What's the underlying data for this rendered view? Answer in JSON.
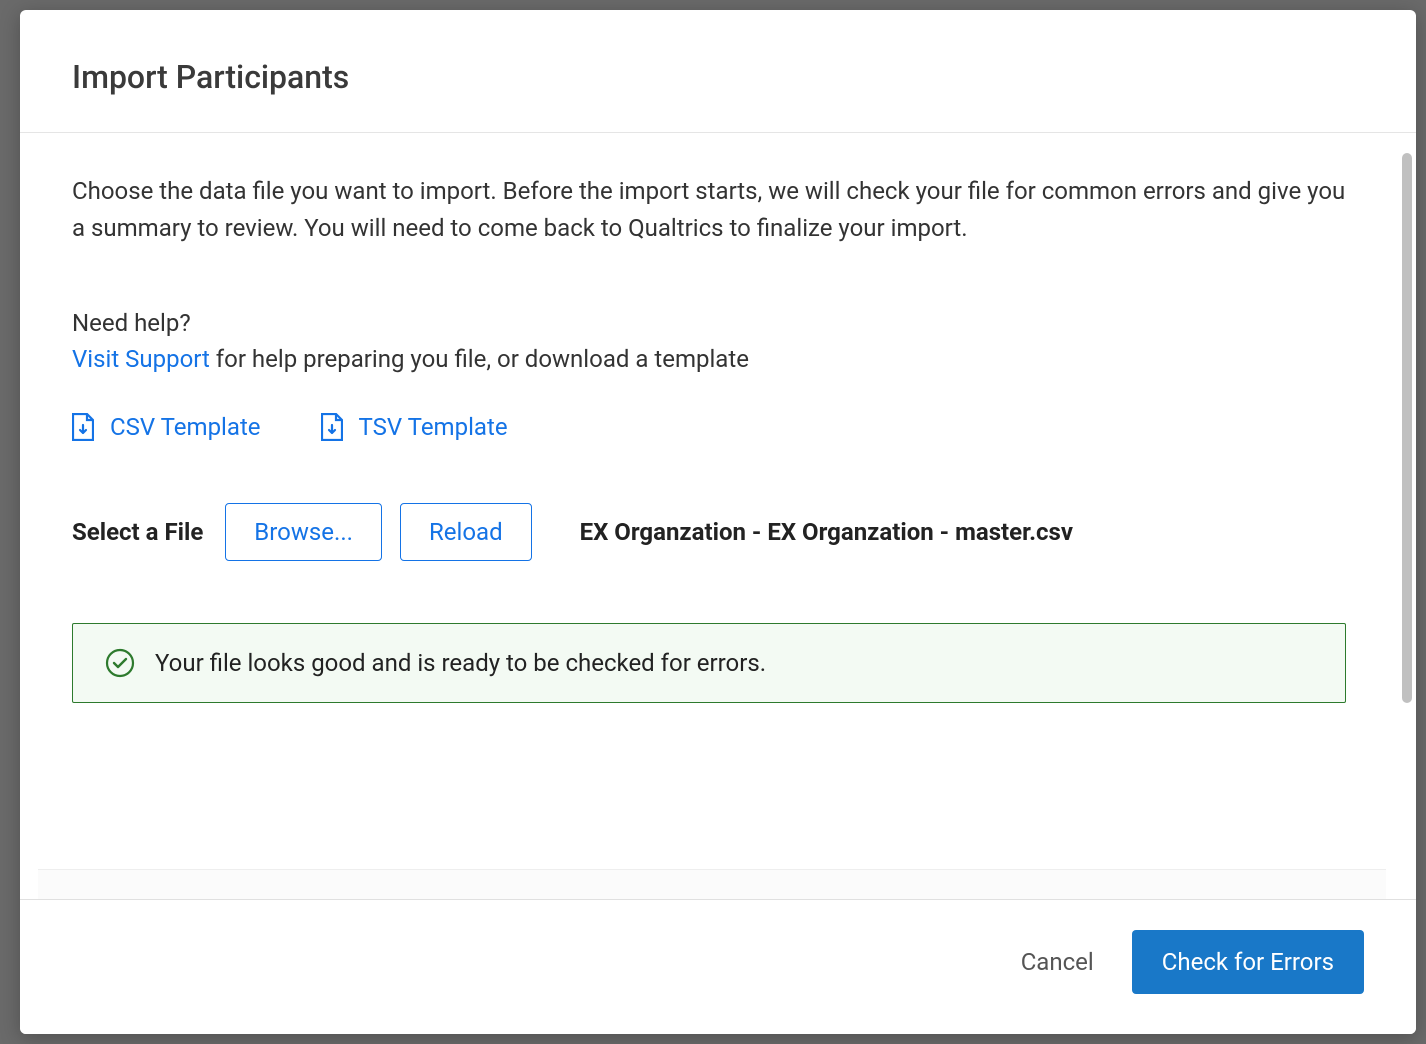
{
  "modal": {
    "title": "Import Participants",
    "intro": "Choose the data file you want to import. Before the import starts, we will check your file for common errors and give you a summary to review. You will need to come back to Qualtrics to finalize your import.",
    "help": {
      "heading": "Need help?",
      "link_text": "Visit Support",
      "rest": " for help preparing you file, or download a template"
    },
    "templates": {
      "csv": "CSV Template",
      "tsv": "TSV Template"
    },
    "file_select": {
      "label": "Select a File",
      "browse": "Browse...",
      "reload": "Reload",
      "filename": "EX Organzation - EX Organzation - master.csv"
    },
    "status": {
      "message": "Your file looks good and is ready to be checked for errors."
    },
    "footer": {
      "cancel": "Cancel",
      "primary": "Check for Errors"
    }
  }
}
